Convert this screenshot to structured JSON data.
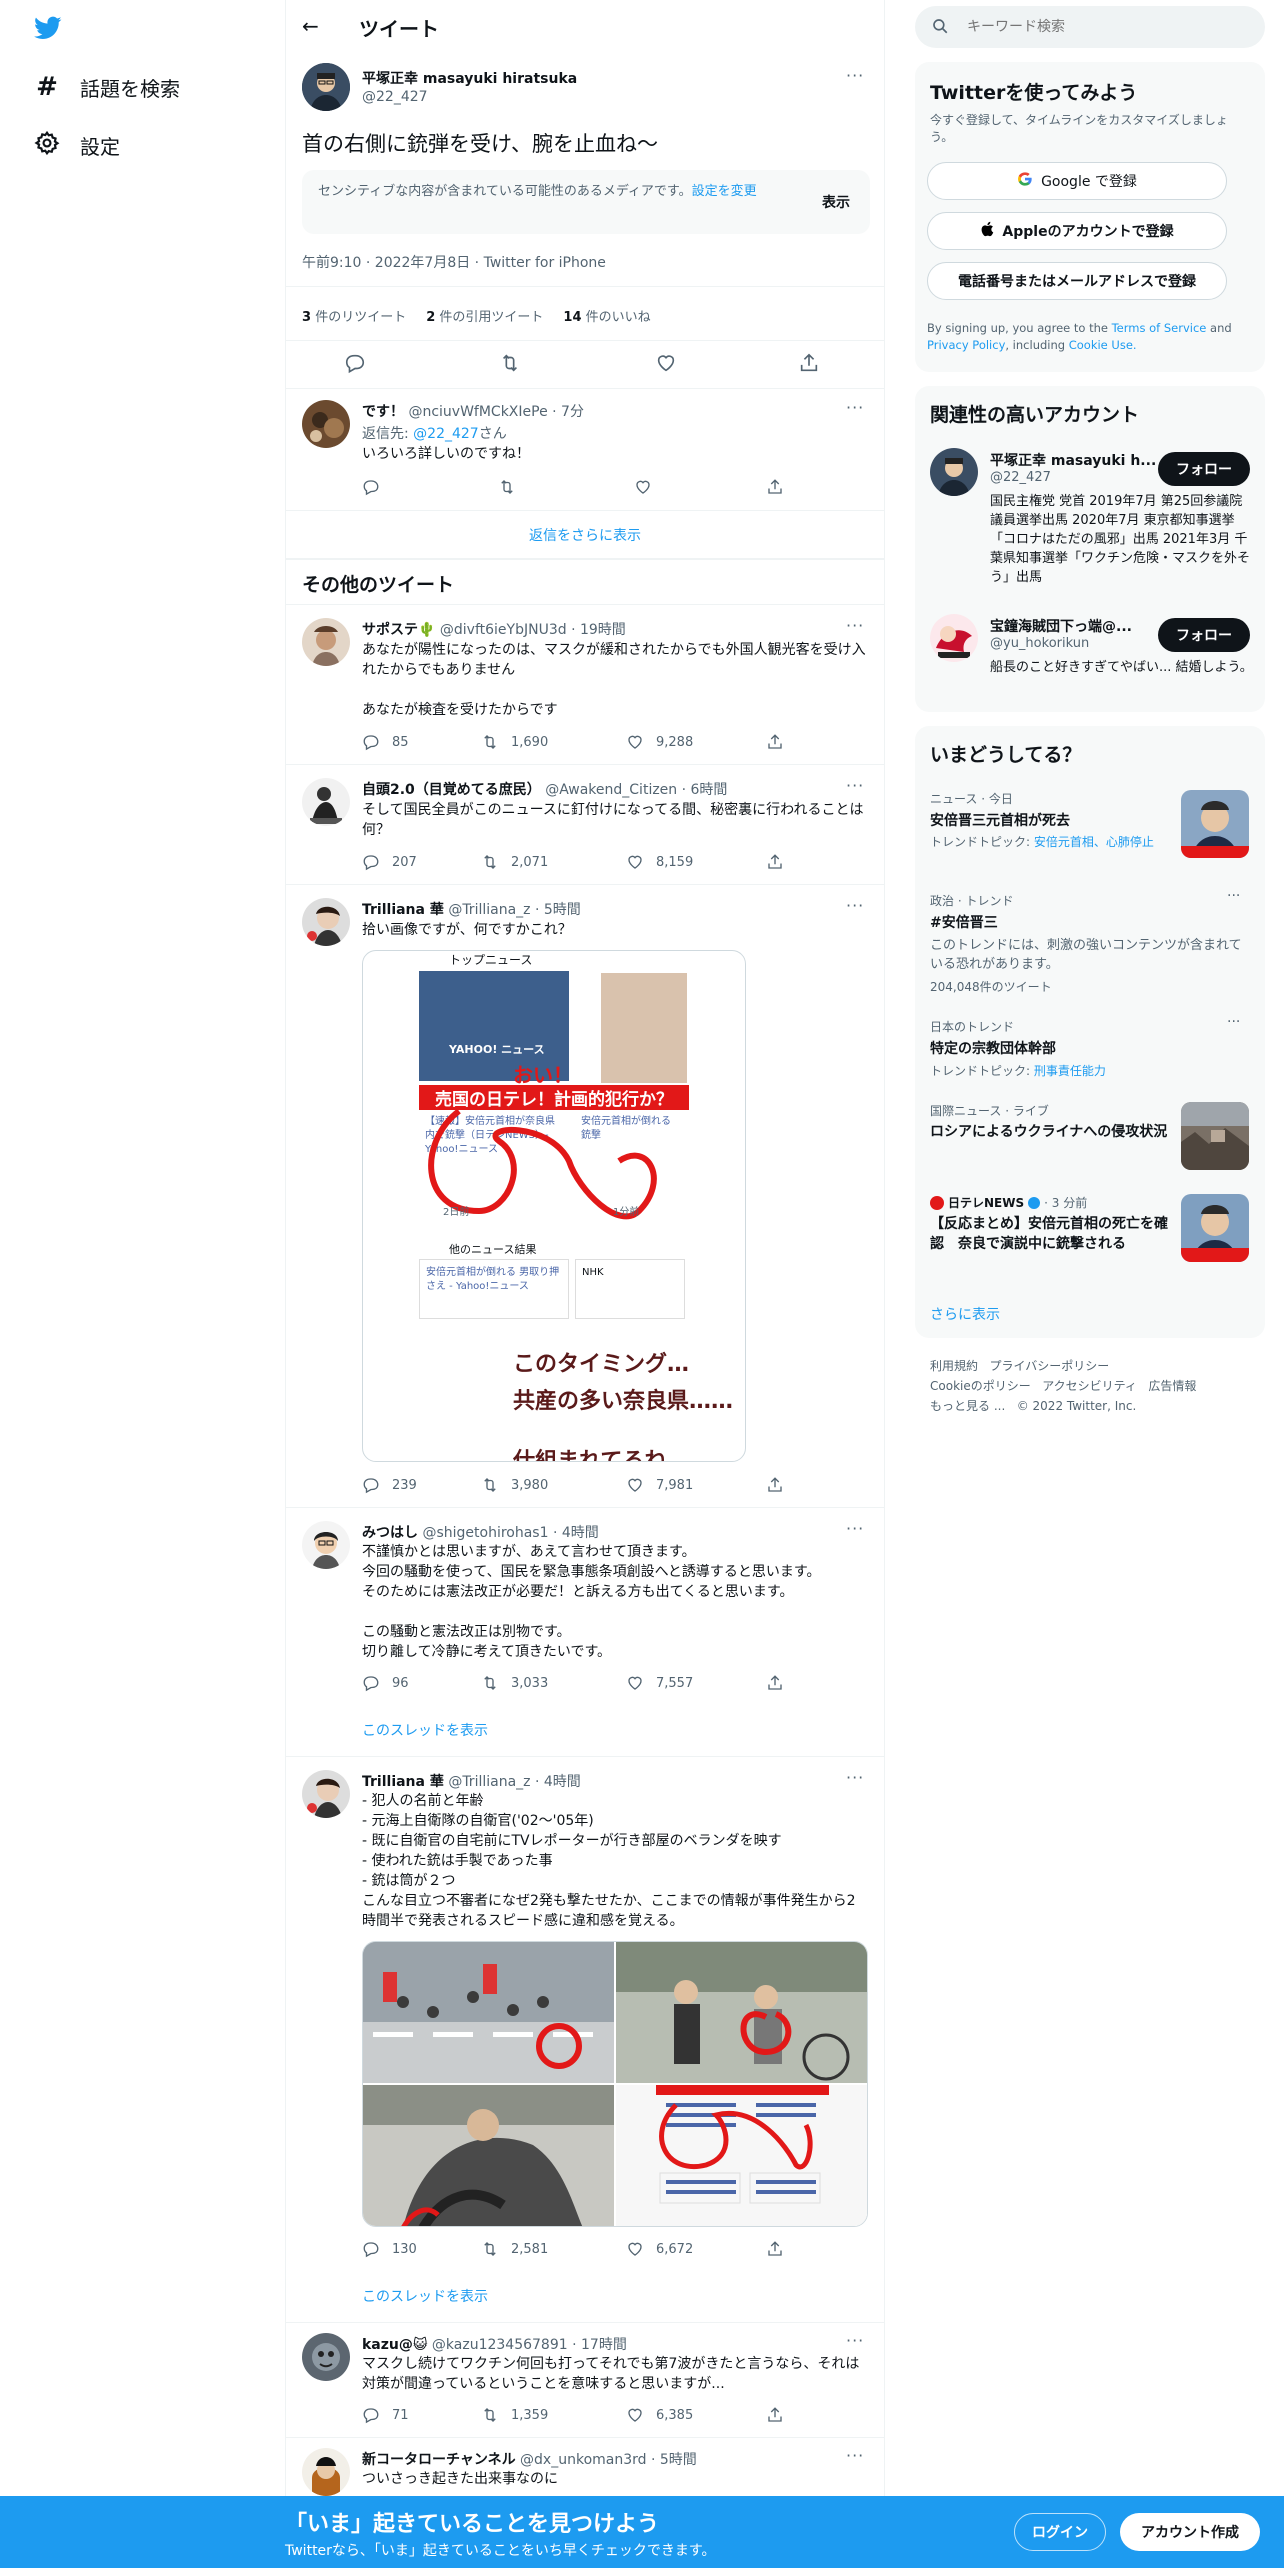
{
  "nav": {
    "explore_label": "話題を検索",
    "settings_label": "設定"
  },
  "header": {
    "title": "ツイート"
  },
  "tweet": {
    "name": "平塚正幸 masayuki hiratsuka",
    "handle": "@22_427",
    "text": "首の右側に銃弾を受け、腕を止血ね〜",
    "sensitive_notice": "センシティブな内容が含まれている可能性のあるメディアです。",
    "sensitive_change": "設定を変更",
    "sensitive_show": "表示",
    "meta": "午前9:10 · 2022年7月8日 · Twitter for iPhone",
    "retweets_count": "3",
    "retweets_label": "件のリツイート",
    "quotes_count": "2",
    "quotes_label": "件の引用ツイート",
    "likes_count": "14",
    "likes_label": "件のいいね"
  },
  "reply": {
    "name": "です！",
    "handle": "@nciuvWfMCkXIePe · 7分",
    "reply_to_prefix": "返信先: ",
    "reply_to_handle": "@22_427",
    "reply_to_suffix": "さん",
    "text": "いろいろ詳しいのですね！"
  },
  "show_more_replies": "返信をさらに表示",
  "other_tweets_heading": "その他のツイート",
  "others": [
    {
      "name": "サポステ🌵",
      "handle": "@divft6ieYbJNU3d · 19時間",
      "text": "あなたが陽性になったのは、マスクが緩和されたからでも外国人観光客を受け入れたからでもありません\n\nあなたが検査を受けたからです",
      "replies": "85",
      "retweets": "1,690",
      "likes": "9,288"
    },
    {
      "name": "自頭2.0（目覚めてる庶民）",
      "handle": "@Awakend_Citizen · 6時間",
      "text": "そして国民全員がこのニュースに釘付けになってる間、秘密裏に行われることは何？",
      "replies": "207",
      "retweets": "2,071",
      "likes": "8,159"
    },
    {
      "name": "Trilliana 華",
      "handle": "@Trilliana_z · 5時間",
      "text": "拾い画像ですが、何ですかこれ？",
      "replies": "239",
      "retweets": "3,980",
      "likes": "7,981",
      "image_texts": {
        "top_news": "トップニュース",
        "yahoo": "YAHOO! ニュース",
        "oi": "おい！",
        "banner": "売国の日テレ！計画的犯行か？",
        "headline1": "【速報】安倍元首相が奈良県内で銃撃（日テレNEWS）- Yahoo!ニュース",
        "headline2": "安倍元首相が倒れる 男取り押さえ - Yahoo!ニュース",
        "headline3": "安倍元首相が倒れる銃撃",
        "ago1": "2日前",
        "ago2": "1分前",
        "other_news": "他のニュース結果",
        "nhk": "NHK",
        "caption1": "このタイミング…",
        "caption2": "共産の多い奈良県……",
        "caption3": "仕組まれてるね"
      }
    },
    {
      "name": "みつはし",
      "handle": "@shigetohirohas1 · 4時間",
      "text": "不謹慎かとは思いますが、あえて言わせて頂きます。\n今回の騒動を使って、国民を緊急事態条項創設へと誘導すると思います。\nそのためには憲法改正が必要だ！と訴える方も出てくると思います。\n\nこの騒動と憲法改正は別物です。\n切り離して冷静に考えて頂きたいです。",
      "replies": "96",
      "retweets": "3,033",
      "likes": "7,557",
      "thread": "このスレッドを表示"
    },
    {
      "name": "Trilliana 華",
      "handle": "@Trilliana_z · 4時間",
      "text": "- 犯人の名前と年齢\n- 元海上自衛隊の自衛官('02〜'05年)\n- 既に自衛官の自宅前にTVレポーターが行き部屋のベランダを映す\n- 使われた銃は手製であった事\n- 銃は筒が２つ\nこんな目立つ不審者になぜ2発も撃たせたか、ここまでの情報が事件発生から2時間半で発表されるスピード感に違和感を覚える。",
      "replies": "130",
      "retweets": "2,581",
      "likes": "6,672",
      "thread": "このスレッドを表示"
    },
    {
      "name": "kazu@😺",
      "handle": "@kazu1234567891 · 17時間",
      "text": "マスクし続けてワクチン何回も打ってそれでも第7波がきたと言うなら、それは対策が間違っているということを意味すると思いますが...",
      "replies": "71",
      "retweets": "1,359",
      "likes": "6,385"
    },
    {
      "name": "新コータローチャンネル",
      "handle": "@dx_unkoman3rd · 5時間",
      "text": "ついさっき起きた出来事なのに"
    }
  ],
  "search": {
    "placeholder": "キーワード検索"
  },
  "signup": {
    "title": "Twitterを使ってみよう",
    "subtitle": "今すぐ登録して、タイムラインをカスタマイズしましょう。",
    "google": "Google で登録",
    "apple": "Appleのアカウントで登録",
    "phone": "電話番号またはメールアドレスで登録",
    "terms_prefix": "By signing up, you agree to the ",
    "terms": "Terms of Service",
    "and": " and ",
    "privacy": "Privacy Policy",
    "including": ", including ",
    "cookie": "Cookie Use."
  },
  "related": {
    "title": "関連性の高いアカウント",
    "accounts": [
      {
        "name": "平塚正幸 masayuki h...",
        "handle": "@22_427",
        "bio": "国民主権党 党首 2019年7月 第25回参議院議員選挙出馬 2020年7月 東京都知事選挙「コロナはただの風邪」出馬 2021年3月 千葉県知事選挙「ワクチン危険・マスクを外そう」出馬",
        "follow": "フォロー"
      },
      {
        "name": "宝鐘海賊団下っ端@...",
        "handle": "@yu_hokorikun",
        "bio": "船長のこと好きすぎてやばい... 結婚しよう。",
        "follow": "フォロー"
      }
    ]
  },
  "trends": {
    "title": "いまどうしてる？",
    "items": [
      {
        "category": "ニュース · 今日",
        "name": "安倍晋三元首相が死去",
        "extra_prefix": "トレンドトピック: ",
        "extra": "安倍元首相、心肺停止"
      },
      {
        "category": "政治 · トレンド",
        "name": "#安倍晋三",
        "desc": "このトレンドには、刺激の強いコンテンツが含まれている恐れがあります。",
        "count": "204,048件のツイート"
      },
      {
        "category": "日本のトレンド",
        "name": "特定の宗教団体幹部",
        "extra_prefix": "トレンドトピック: ",
        "extra": "刑事責任能力"
      },
      {
        "category": "国際ニュース · ライブ",
        "name": "ロシアによるウクライナへの侵攻状況"
      },
      {
        "source": "日テレNEWS",
        "time": " · 3 分前",
        "name": "【反応まとめ】安倍元首相の死亡を確認　奈良で演説中に銃撃される"
      }
    ],
    "show_more": "さらに表示"
  },
  "footer": {
    "links": [
      "利用規約",
      "プライバシーポリシー",
      "Cookieのポリシー",
      "アクセシビリティ",
      "広告情報",
      "もっと見る ...",
      "© 2022 Twitter, Inc."
    ]
  },
  "banner": {
    "title": "「いま」起きていることを見つけよう",
    "subtitle": "Twitterなら、「いま」起きていることをいち早くチェックできます。",
    "login": "ログイン",
    "signup": "アカウント作成"
  },
  "colors": {
    "accent": "#1d9bf0",
    "text": "#0f1419",
    "muted": "#536471"
  }
}
